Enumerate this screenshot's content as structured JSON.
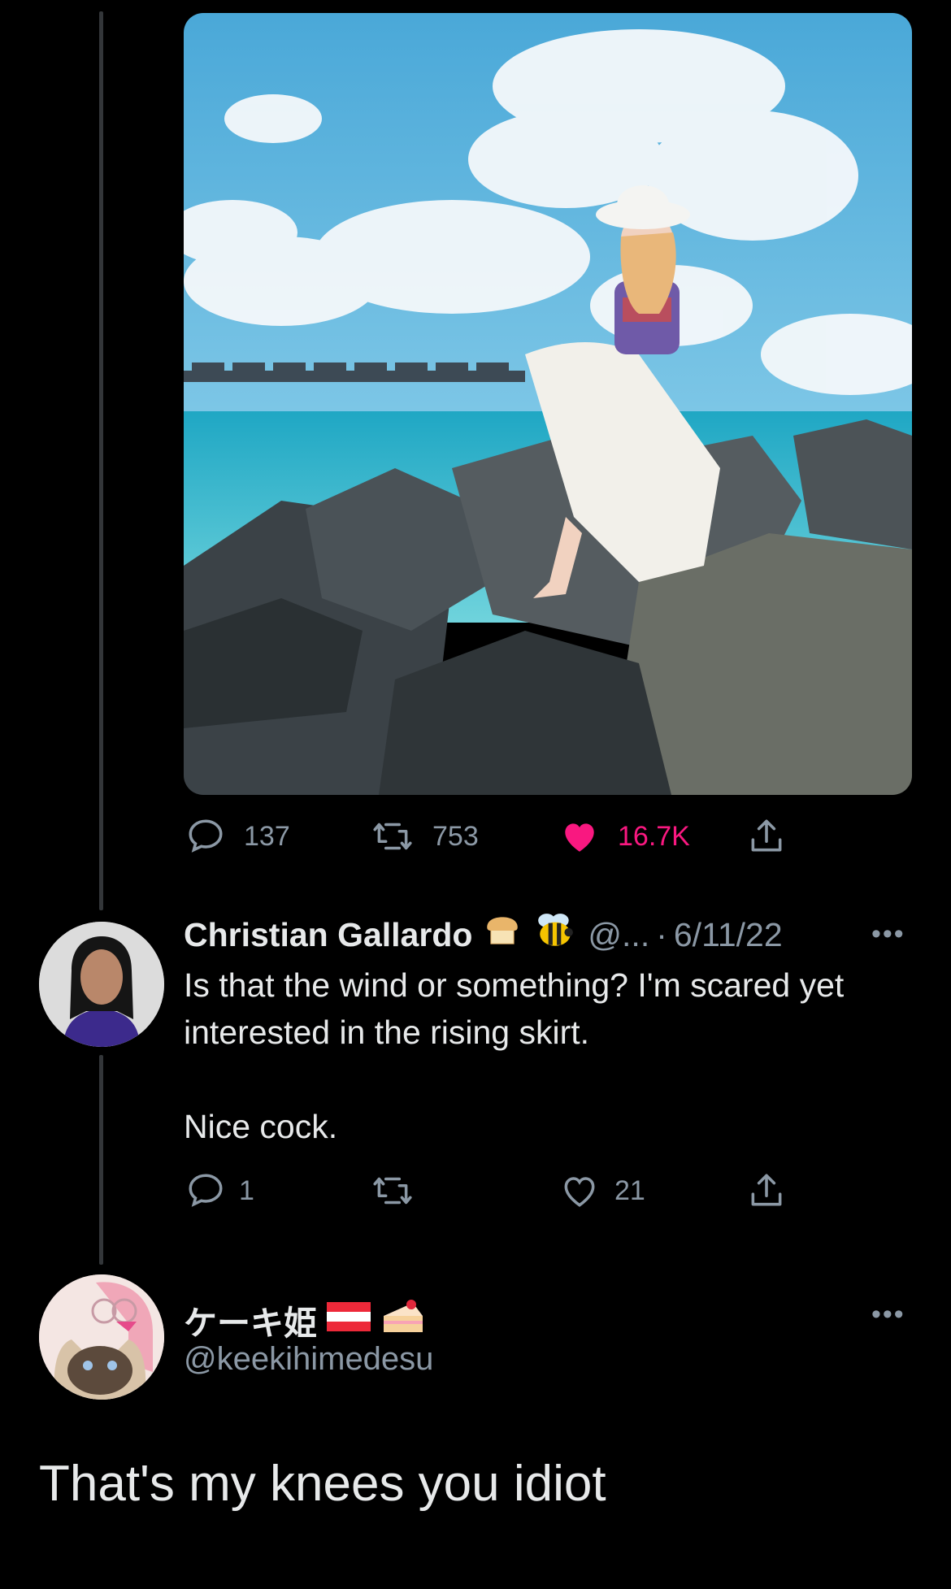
{
  "main_photo": {
    "alt": ""
  },
  "main_actions": {
    "replies": "137",
    "retweets": "753",
    "likes": "16.7K"
  },
  "reply": {
    "name": "Christian Gallardo",
    "name_emojis": [
      "bread-emoji",
      "bee-emoji"
    ],
    "handle_truncated": "@...",
    "separator": "·",
    "date": "6/11/22",
    "text_line1": "Is that the wind or something? I'm scared yet interested in the rising skirt.",
    "text_line2": "Nice cock.",
    "more": "•••",
    "actions": {
      "replies": "1",
      "retweets": "",
      "likes": "21"
    }
  },
  "focused_tweet": {
    "name": "ケーキ姫",
    "name_emojis": [
      "austria-flag-emoji",
      "cake-emoji"
    ],
    "handle": "@keekihimedesu",
    "more": "•••",
    "text": "That's my knees you idiot"
  },
  "colors": {
    "background": "#000000",
    "text_primary": "#e7e9ea",
    "text_secondary": "#8b98a5",
    "like_active": "#f91880",
    "thread_line": "#333639"
  }
}
